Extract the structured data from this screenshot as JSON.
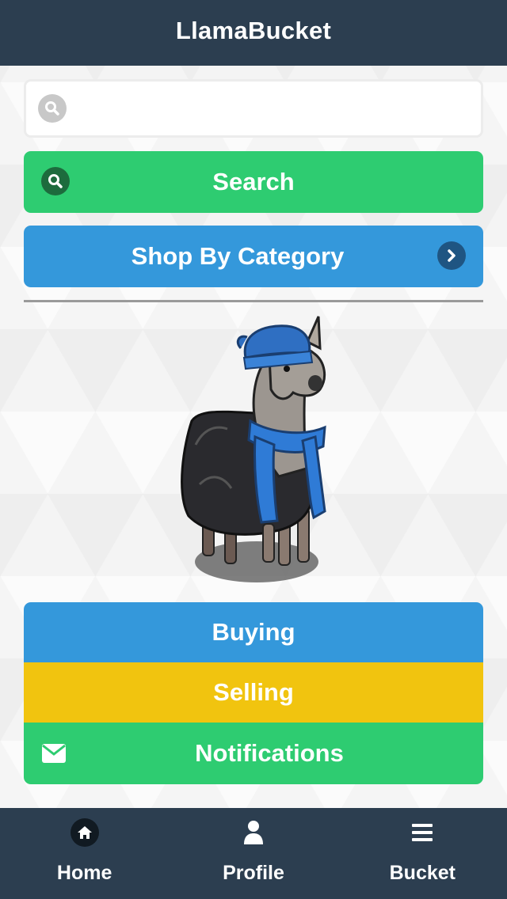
{
  "app": {
    "title": "LlamaBucket"
  },
  "search": {
    "placeholder": "",
    "value": "",
    "icon": "search-icon",
    "button_label": "Search"
  },
  "category": {
    "label": "Shop By Category",
    "icon": "chevron-right-icon"
  },
  "menu": {
    "items": [
      {
        "label": "Buying",
        "color": "#3498db"
      },
      {
        "label": "Selling",
        "color": "#f1c40f"
      },
      {
        "label": "Notifications",
        "color": "#2ecc71",
        "icon": "envelope-icon"
      }
    ]
  },
  "tabbar": {
    "items": [
      {
        "label": "Home",
        "icon": "home-icon"
      },
      {
        "label": "Profile",
        "icon": "user-icon"
      },
      {
        "label": "Bucket",
        "icon": "bars-icon"
      }
    ]
  },
  "colors": {
    "header": "#2c3e50",
    "green": "#2ecc71",
    "blue": "#3498db",
    "yellow": "#f1c40f"
  }
}
